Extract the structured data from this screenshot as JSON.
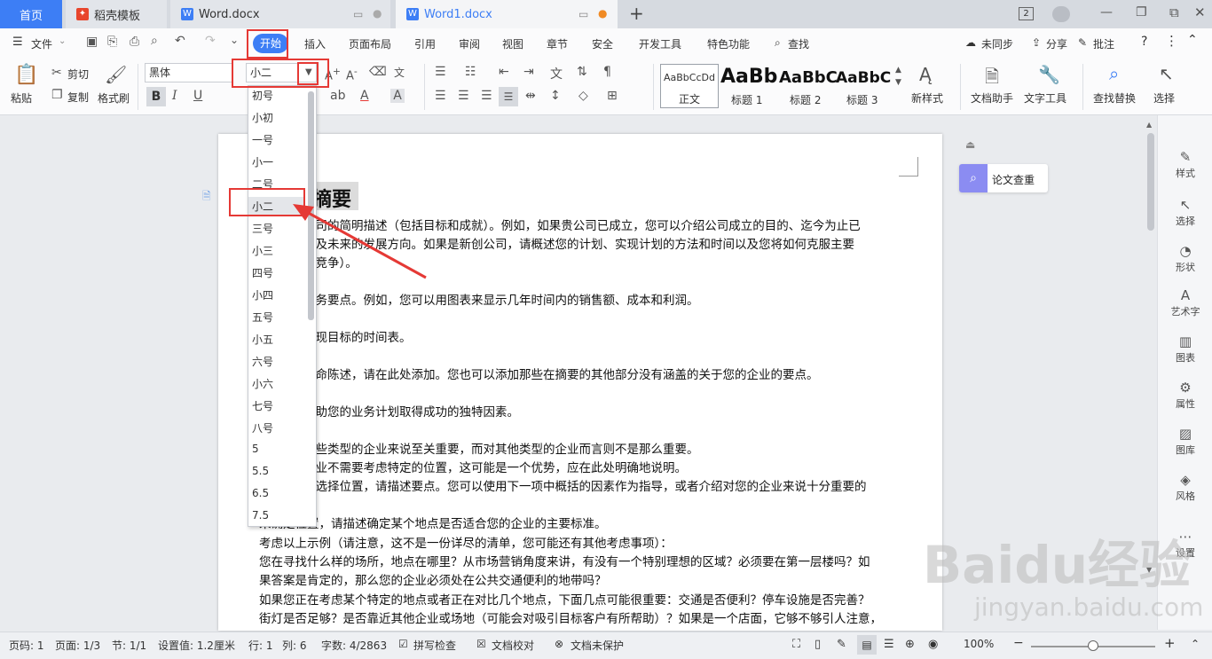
{
  "tabs": {
    "home": "首页",
    "tab1": "稻壳模板",
    "tab2": "Word.docx",
    "tab3": "Word1.docx",
    "add": "+",
    "window_count": "2"
  },
  "menu": {
    "file": "文件",
    "items": [
      "开始",
      "插入",
      "页面布局",
      "引用",
      "审阅",
      "视图",
      "章节",
      "安全",
      "开发工具",
      "特色功能"
    ],
    "search": "查找",
    "sync": "未同步",
    "share": "分享",
    "annotate": "批注",
    "help": "?"
  },
  "ribbon": {
    "paste": "粘贴",
    "cut": "剪切",
    "copy": "复制",
    "format_painter": "格式刷",
    "font_name": "黑体",
    "font_size": "小二",
    "styles": [
      {
        "preview": "AaBbCcDd",
        "name": "正文"
      },
      {
        "preview": "AaBb",
        "name": "标题 1"
      },
      {
        "preview": "AaBbC",
        "name": "标题 2"
      },
      {
        "preview": "AaBbC",
        "name": "标题 3"
      }
    ],
    "new_style": "新样式",
    "doc_assistant": "文档助手",
    "text_tools": "文字工具",
    "find_replace": "查找替换",
    "select": "选择"
  },
  "font_size_options": [
    "初号",
    "小初",
    "一号",
    "小一",
    "二号",
    "小二",
    "三号",
    "小三",
    "四号",
    "小四",
    "五号",
    "小五",
    "六号",
    "小六",
    "七号",
    "八号",
    "5",
    "5.5",
    "6.5",
    "7.5"
  ],
  "font_size_selected": "小二",
  "document": {
    "heading": "摘要",
    "lines": [
      "公司的简明描述（包括目标和成就）。例如，如果贵公司已成立，您可以介绍公司成立的目的、迄今为止已",
      "以及未来的发展方向。如果是新创公司，请概述您的计划、实现计划的方法和时间以及您将如何克服主要",
      "如竞争）。",
      "业务要点。例如，您可以用图表来显示几年时间内的销售额、成本和利润。",
      "实现目标的时间表。",
      "使命陈述，请在此处添加。您也可以添加那些在摘要的其他部分没有涵盖的关于您的企业的要点。",
      "帮助您的业务计划取得成功的独特因素。",
      "某些类型的企业来说至关重要，而对其他类型的企业而言则不是那么重要。",
      "企业不需要考虑特定的位置，这可能是一个优势，应在此处明确地说明。",
      "经选择位置，请描述要点。您可以使用下一项中概括的因素作为指导，或者介绍对您的企业来说十分重要的",
      "未确定位置，请描述确定某个地点是否适合您的企业的主要标准。",
      "考虑以上示例（请注意，这不是一份详尽的清单，您可能还有其他考虑事项）：",
      "您在寻找什么样的场所，地点在哪里？从市场营销角度来讲，有没有一个特别理想的区域？必须要在第一层楼吗？如",
      "果答案是肯定的，那么您的企业必须处在公共交通便利的地带吗？",
      "如果您正在考虑某个特定的地点或者正在对比几个地点，下面几点可能很重要：交通是否便利？停车设施是否完善？",
      "街灯是否足够？是否靠近其他企业或场地（可能会对吸引目标客户有所帮助）？如果是一个店面，它够不够引人注意，"
    ]
  },
  "side_button": "论文查重",
  "right_panel": [
    "样式",
    "选择",
    "形状",
    "艺术字",
    "图表",
    "属性",
    "图库",
    "风格",
    "设置"
  ],
  "status": {
    "page": "页码: 1",
    "pages": "页面: 1/3",
    "section": "节: 1/1",
    "setting": "设置值: 1.2厘米",
    "row": "行: 1",
    "col": "列: 6",
    "words": "字数: 4/2863",
    "spell": "拼写检查",
    "proof": "文档校对",
    "protect": "文档未保护",
    "zoom": "100%"
  },
  "watermark": {
    "brand": "Baidu经验",
    "url": "jingyan.baidu.com"
  },
  "colors": {
    "accent": "#3d7ef5",
    "highlight": "#e53935"
  }
}
